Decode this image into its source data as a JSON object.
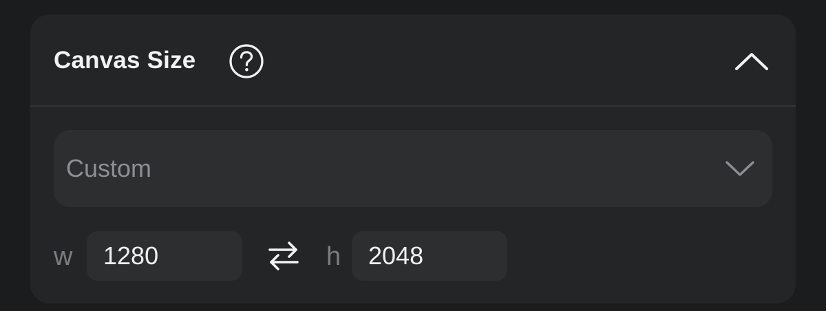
{
  "panel": {
    "title": "Canvas Size",
    "help_icon": "help-circle-icon",
    "collapse_icon": "chevron-up-icon",
    "expanded": true
  },
  "preset": {
    "selected": "Custom",
    "chevron_icon": "chevron-down-icon"
  },
  "dimensions": {
    "width_label": "w",
    "width_value": "1280",
    "height_label": "h",
    "height_value": "2048",
    "swap_icon": "swap-arrows-icon"
  },
  "colors": {
    "background": "#1b1c1e",
    "panel": "#242527",
    "field": "#2d2e30",
    "text": "#f2f2f2",
    "muted_text": "#8e8f92"
  }
}
